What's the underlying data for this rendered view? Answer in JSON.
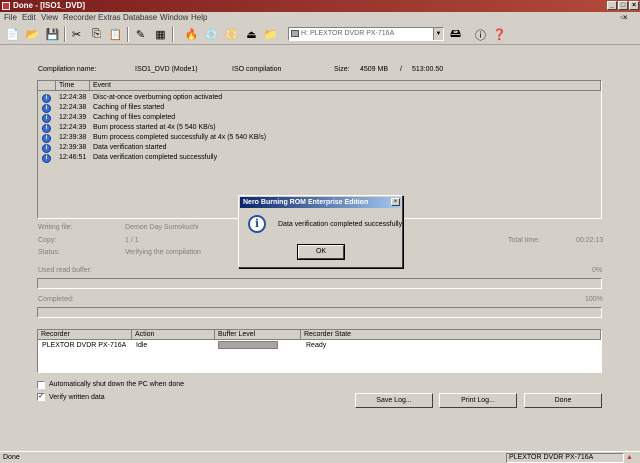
{
  "window": {
    "title": "Done - [ISO1_DVD]"
  },
  "menu": [
    "File",
    "Edit",
    "View",
    "Recorder",
    "Extras",
    "Database",
    "Window",
    "Help"
  ],
  "toolbar": {
    "drive_label": "H: PLEXTOR DVDR  PX-716A"
  },
  "info": {
    "compilation_name_label": "Compilation name:",
    "compilation_name": "ISO1_DVD (Mode1)",
    "compilation_type": "ISO compilation",
    "size_label": "Size:",
    "size_mb": "4509 MB",
    "size_time": "513:00.50"
  },
  "log": {
    "headers": {
      "time": "Time",
      "event": "Event"
    },
    "rows": [
      {
        "time": "12:24:38",
        "event": "Disc-at-once overburning option activated"
      },
      {
        "time": "12:24:38",
        "event": "Caching of files started"
      },
      {
        "time": "12:24:39",
        "event": "Caching of files completed"
      },
      {
        "time": "12:24:39",
        "event": "Burn process started at 4x (5 540 KB/s)"
      },
      {
        "time": "12:39:38",
        "event": "Burn process completed successfully at 4x (5 540 KB/s)"
      },
      {
        "time": "12:39:38",
        "event": "Data verification started"
      },
      {
        "time": "12:46:51",
        "event": "Data verification completed successfully"
      }
    ]
  },
  "progress": {
    "writing_file_label": "Writing file:",
    "writing_file_value": "Demon Day Sumokuchi",
    "copy_label": "Copy:",
    "copy_value": "1 / 1",
    "status_label": "Status:",
    "status_value": "Verifying the compilation",
    "total_time_label": "Total time:",
    "total_time_value": "00:22:13",
    "buffer_label": "Used read buffer:",
    "buffer_value": "0%",
    "completed_label": "Completed:",
    "completed_value": "100%"
  },
  "recorder": {
    "headers": {
      "recorder": "Recorder",
      "action": "Action",
      "buffer": "Buffer Level",
      "state": "Recorder State"
    },
    "row": {
      "recorder": "PLEXTOR DVDR   PX-716A",
      "action": "Idle",
      "state": "Ready"
    }
  },
  "options": {
    "auto_shutdown_label": "Automatically shut down the PC when done",
    "auto_shutdown_checked": false,
    "verify_label": "Verify written data",
    "verify_checked": true
  },
  "buttons": {
    "save_log": "Save Log...",
    "print_log": "Print Log...",
    "done": "Done"
  },
  "dialog": {
    "title": "Nero Burning ROM Enterprise Edition",
    "message": "Data verification completed successfully",
    "ok": "OK"
  },
  "statusbar": {
    "text": "Done",
    "drive": "PLEXTOR  DVDR   PX-716A"
  }
}
